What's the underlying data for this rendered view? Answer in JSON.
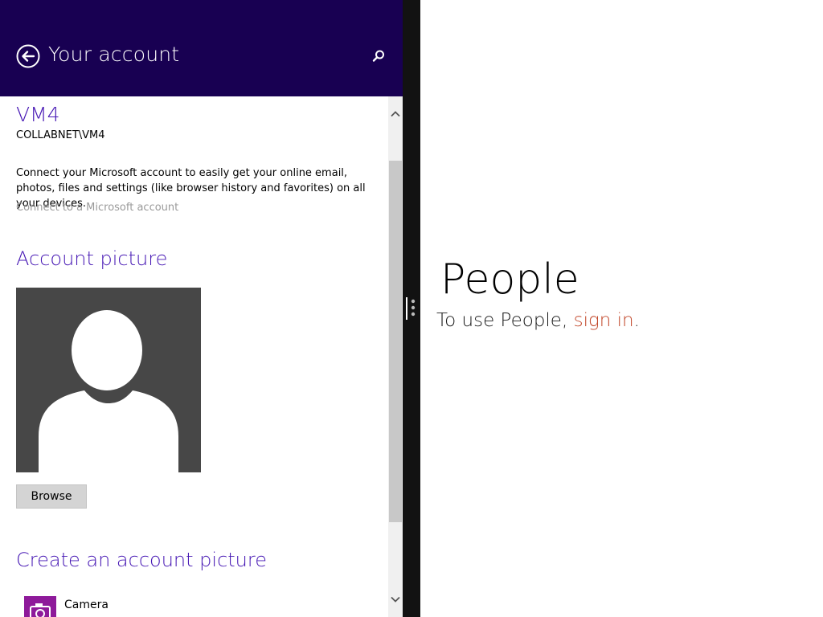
{
  "left_pane": {
    "header": {
      "title": "Your account",
      "back_icon": "back-arrow-circle-icon",
      "search_icon": "search-icon",
      "background": "#180052"
    },
    "user": {
      "name": "VM4",
      "domain": "COLLABNET\\VM4"
    },
    "connect": {
      "description": "Connect your Microsoft account to easily get your online email, photos, files and settings (like browser history and favorites) on all your devices.",
      "link_label": "Connect to a Microsoft account"
    },
    "account_picture": {
      "title": "Account picture",
      "browse_label": "Browse"
    },
    "create_picture": {
      "title": "Create an account picture",
      "apps": [
        {
          "label": "Camera",
          "icon": "camera-icon",
          "tile_color": "#8e1a9a"
        }
      ]
    },
    "accent_color": "#4617b4"
  },
  "right_pane": {
    "app_title": "People",
    "signin_prefix": "To use People, ",
    "signin_link": "sign in",
    "signin_suffix": ".",
    "link_color": "#c2472a"
  }
}
